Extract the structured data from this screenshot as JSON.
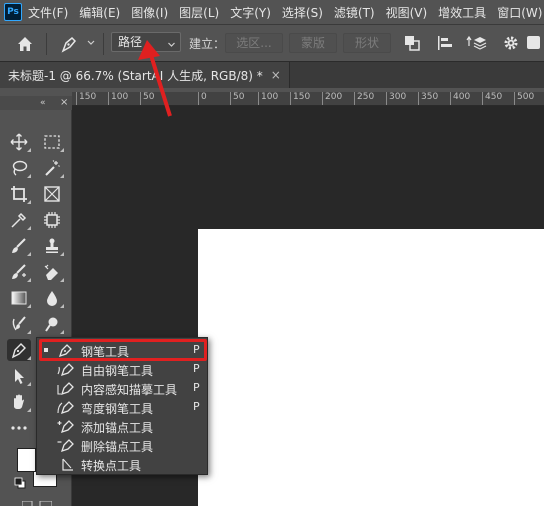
{
  "app": {
    "logo_text": "Ps"
  },
  "menu": {
    "items": [
      "文件(F)",
      "编辑(E)",
      "图像(I)",
      "图层(L)",
      "文字(Y)",
      "选择(S)",
      "滤镜(T)",
      "视图(V)",
      "增效工具",
      "窗口(W)"
    ]
  },
  "options_bar": {
    "mode_value": "路径",
    "build_label": "建立：",
    "selection_button": "选区...",
    "mask_button": "蒙版",
    "shape_button": "形状"
  },
  "document_tab": {
    "title": "未标题-1 @ 66.7% (StartAI 人生成, RGB/8) *",
    "close": "×"
  },
  "ruler": {
    "labels": [
      "150",
      "100",
      "50",
      "0",
      "50",
      "100",
      "150",
      "200",
      "250",
      "300",
      "350",
      "400",
      "450",
      "500"
    ]
  },
  "toolbar": {
    "collapse": "«",
    "close": "×"
  },
  "flyout": {
    "items": [
      {
        "label": "钢笔工具",
        "key": "P",
        "icon": "pen-icon",
        "selected": true
      },
      {
        "label": "自由钢笔工具",
        "key": "P",
        "icon": "freeform-pen-icon",
        "selected": false
      },
      {
        "label": "内容感知描摹工具",
        "key": "P",
        "icon": "content-aware-tracing-icon",
        "selected": false
      },
      {
        "label": "弯度钢笔工具",
        "key": "P",
        "icon": "curvature-pen-icon",
        "selected": false
      },
      {
        "label": "添加锚点工具",
        "key": "",
        "icon": "add-anchor-icon",
        "selected": false
      },
      {
        "label": "删除锚点工具",
        "key": "",
        "icon": "delete-anchor-icon",
        "selected": false
      },
      {
        "label": "转换点工具",
        "key": "",
        "icon": "convert-point-icon",
        "selected": false
      }
    ]
  },
  "colors": {
    "annotation": "#e02020",
    "panel": "#535353",
    "workspace": "#282828",
    "canvas": "#ffffff"
  }
}
